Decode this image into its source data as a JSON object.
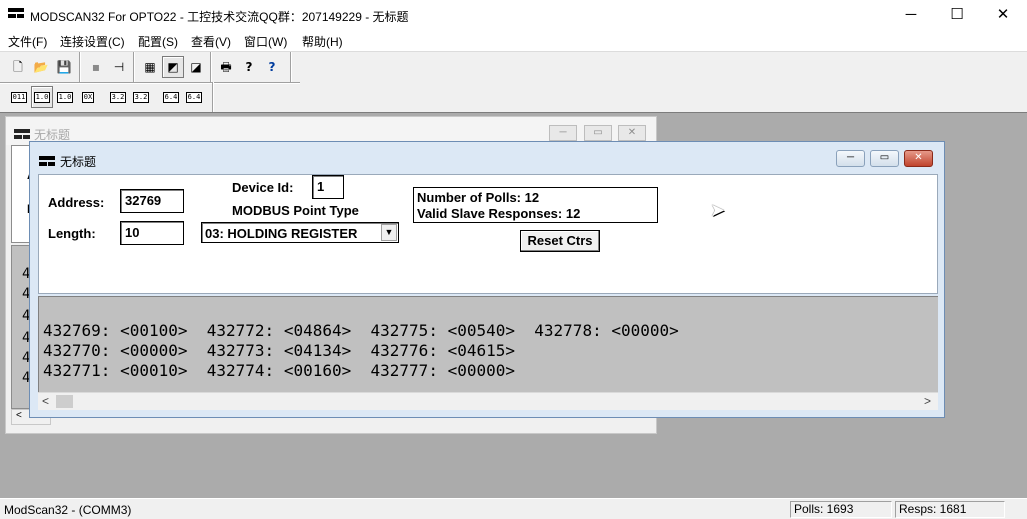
{
  "app": {
    "title": "MODSCAN32 For OPTO22 - 工控技术交流QQ群：207149229 - 无标题",
    "minimize": "─",
    "maximize": "☐",
    "close": "✕"
  },
  "menu": [
    "文件(F)",
    "连接设置(C)",
    "配置(S)",
    "查看(V)",
    "窗口(W)",
    "帮助(H)"
  ],
  "toolbar1": {
    "new": "🗋",
    "open": "📂",
    "save": "💾",
    "print": "🖶",
    "help": "?",
    "context_help": "?"
  },
  "toolbar2": [
    "011",
    "1.0",
    "1.0",
    "0X",
    "3.2",
    "3.2",
    "6.4",
    "6.4"
  ],
  "background_window": {
    "title": "无标题",
    "labels": [
      "A",
      "L"
    ],
    "data_chars": [
      "4",
      "4",
      "4",
      "4",
      "4",
      "4"
    ],
    "scroll_arrow": "<"
  },
  "window": {
    "title": "无标题",
    "address_label": "Address:",
    "address_value": "32769",
    "length_label": "Length:",
    "length_value": "10",
    "device_id_label": "Device Id:",
    "device_id_value": "1",
    "point_type_label": "MODBUS Point Type",
    "point_type_value": "03: HOLDING REGISTER",
    "polls_text": "Number of Polls: 12",
    "responses_text": "Valid Slave Responses: 12",
    "reset_label": "Reset Ctrs",
    "data_lines": [
      "432769: <00100>  432772: <04864>  432775: <00540>  432778: <00000>",
      "432770: <00000>  432773: <04134>  432776: <04615>",
      "432771: <00010>  432774: <00160>  432777: <00000>"
    ],
    "scroll_left": "<",
    "scroll_right": ">"
  },
  "status": {
    "left": "ModScan32 - (COMM3)",
    "polls": "Polls: 1693",
    "resps": "Resps: 1681"
  }
}
